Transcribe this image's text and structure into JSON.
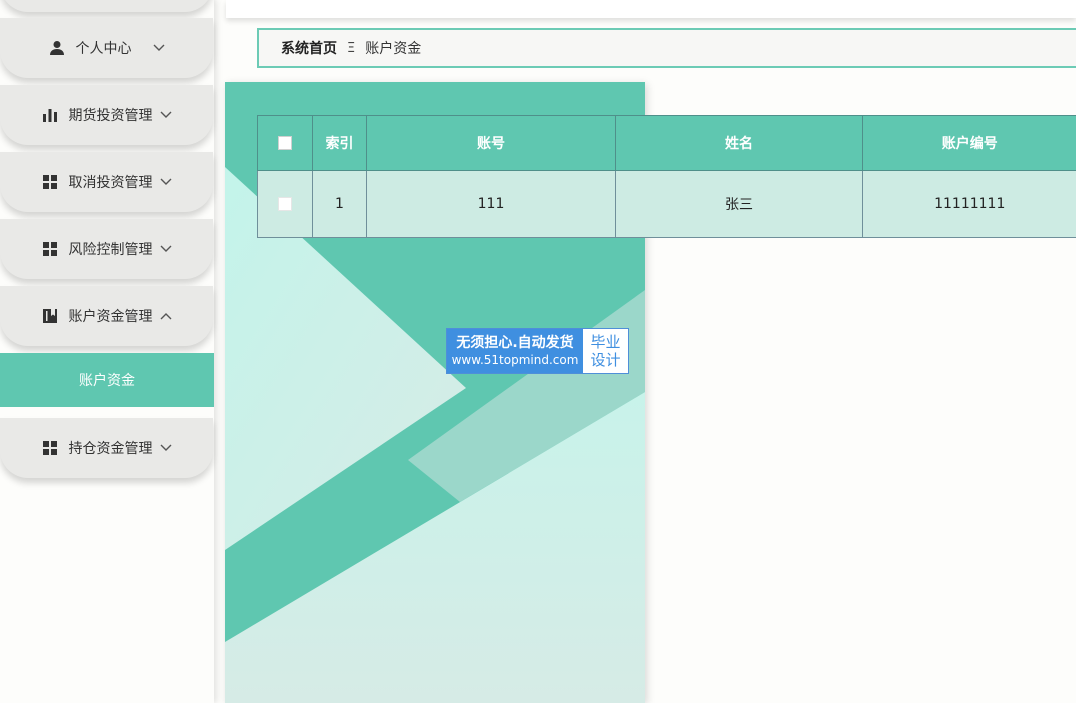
{
  "sidebar": {
    "items": [
      {
        "label": "",
        "icon": "menu-item-icon"
      },
      {
        "label": "个人中心",
        "icon": "user-icon",
        "chevron": "chevron-down-icon"
      },
      {
        "label": "期货投资管理",
        "icon": "bar-chart-icon",
        "chevron": "chevron-down-icon"
      },
      {
        "label": "取消投资管理",
        "icon": "grid-icon",
        "chevron": "chevron-down-icon"
      },
      {
        "label": "风险控制管理",
        "icon": "grid-icon",
        "chevron": "chevron-down-icon"
      },
      {
        "label": "账户资金管理",
        "icon": "book-icon",
        "chevron": "chevron-up-icon"
      },
      {
        "label": "持仓资金管理",
        "icon": "grid-icon",
        "chevron": "chevron-down-icon"
      }
    ],
    "active_subitem": "账户资金"
  },
  "breadcrumb": {
    "home": "系统首页",
    "separator": "Ξ",
    "current": "账户资金"
  },
  "watermark": {
    "line1": "无须担心.自动发货",
    "line2": "www.51topmind.com",
    "badge_line1": "毕业",
    "badge_line2": "设计"
  },
  "table": {
    "headers": [
      "",
      "索引",
      "账号",
      "姓名",
      "账户编号"
    ],
    "rows": [
      {
        "index": "1",
        "account": "111",
        "name": "张三",
        "account_no": "11111111"
      }
    ]
  },
  "colors": {
    "accent": "#5fc7b0",
    "row_bg": "#cdebe3",
    "watermark_blue": "#3f8fe0"
  }
}
